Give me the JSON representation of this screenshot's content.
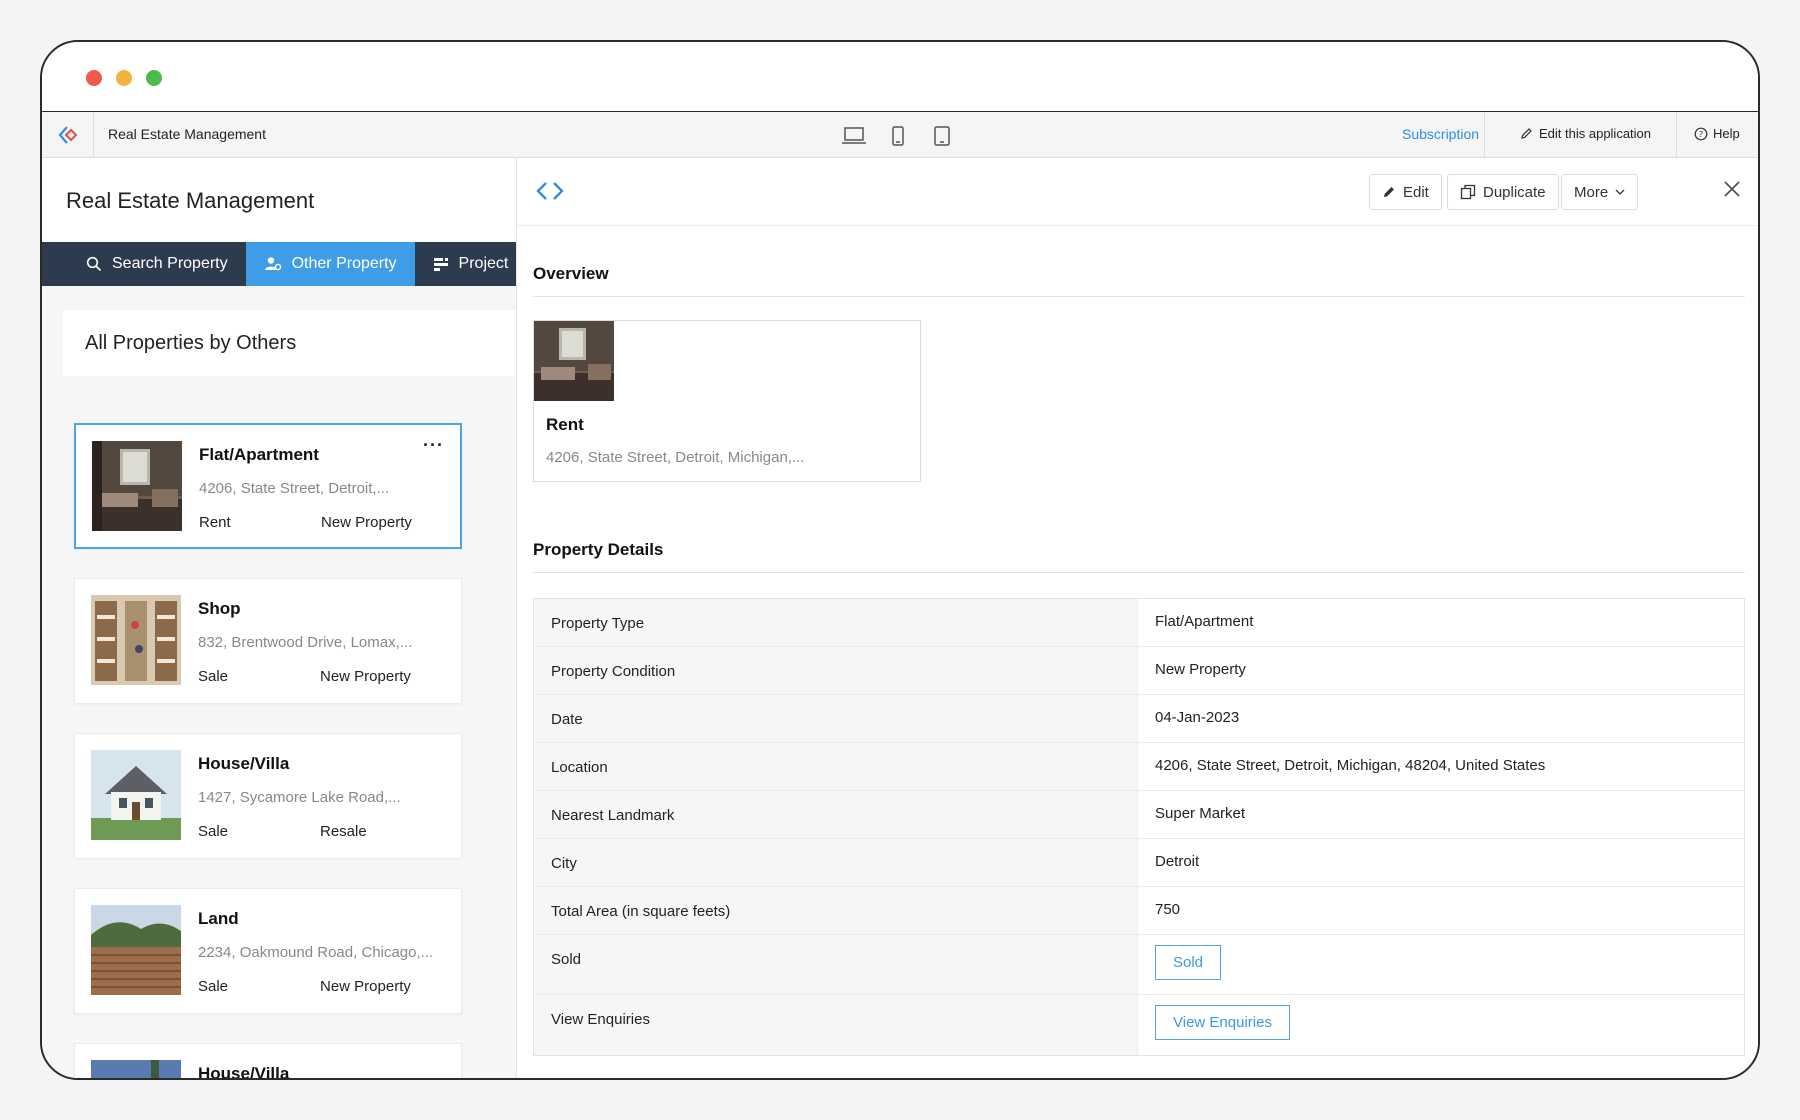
{
  "app": {
    "name": "Real Estate Management",
    "subscription_label": "Subscription",
    "edit_app_label": "Edit this application",
    "help_label": "Help",
    "devices": [
      "laptop-icon",
      "mobile-icon",
      "tablet-icon"
    ]
  },
  "left": {
    "title": "Real Estate Management",
    "tabs": [
      {
        "label": "Search Property",
        "icon": "search-icon",
        "active": false
      },
      {
        "label": "Other Property",
        "icon": "user-group-icon",
        "active": true
      },
      {
        "label": "Project",
        "icon": "project-icon",
        "active": false
      }
    ],
    "list_title": "All Properties by Others",
    "properties": [
      {
        "type": "Flat/Apartment",
        "address": "4206, State Street, Detroit,...",
        "deal": "Rent",
        "condition": "New Property"
      },
      {
        "type": "Shop",
        "address": "832, Brentwood Drive, Lomax,...",
        "deal": "Sale",
        "condition": "New Property"
      },
      {
        "type": "House/Villa",
        "address": "1427, Sycamore Lake Road,...",
        "deal": "Sale",
        "condition": "Resale"
      },
      {
        "type": "Land",
        "address": "2234, Oakmound Road, Chicago,...",
        "deal": "Sale",
        "condition": "New Property"
      },
      {
        "type": "House/Villa"
      }
    ]
  },
  "detail": {
    "toolbar": {
      "edit": "Edit",
      "duplicate": "Duplicate",
      "more": "More"
    },
    "overview_title": "Overview",
    "overview": {
      "deal": "Rent",
      "address": "4206, State Street, Detroit, Michigan,..."
    },
    "details_title": "Property Details",
    "fields": [
      {
        "label": "Property Type",
        "value": "Flat/Apartment"
      },
      {
        "label": "Property Condition",
        "value": "New Property"
      },
      {
        "label": "Date",
        "value": "04-Jan-2023"
      },
      {
        "label": "Location",
        "value": "4206, State Street, Detroit, Michigan, 48204, United States"
      },
      {
        "label": "Nearest Landmark",
        "value": "Super Market"
      },
      {
        "label": "City",
        "value": "Detroit"
      },
      {
        "label": "Total Area (in square feets)",
        "value": "750"
      }
    ],
    "sold_label": "Sold",
    "sold_button": "Sold",
    "enquiries_label": "View Enquiries",
    "enquiries_button": "View Enquiries"
  },
  "colors": {
    "accent": "#3e9de6",
    "tabbar": "#2d3b4e"
  }
}
